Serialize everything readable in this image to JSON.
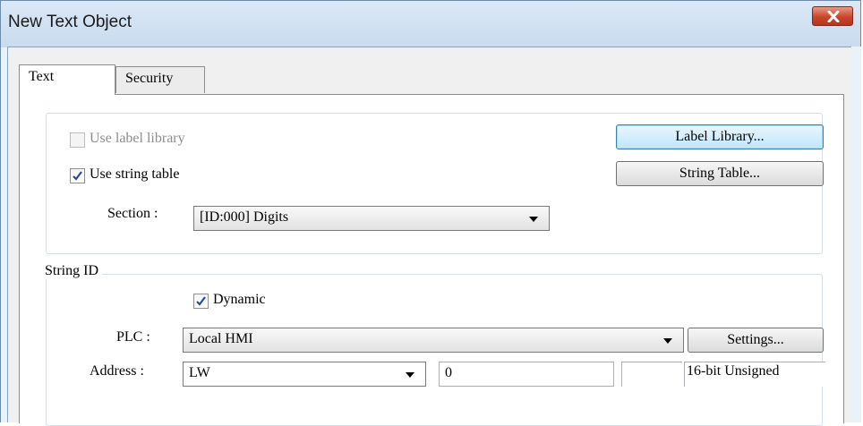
{
  "window": {
    "title": "New Text Object",
    "close_icon": "close-icon",
    "colors": {
      "titlebar": "#c9dbef",
      "close_button": "#c9452b",
      "panel": "#ffffff",
      "default_button": "#bee6fd"
    }
  },
  "tabs": [
    {
      "label": "Text",
      "active": true
    },
    {
      "label": "Security",
      "active": false
    }
  ],
  "label_options": {
    "use_label_library": {
      "label": "Use label library",
      "checked": false,
      "enabled": false
    },
    "use_string_table": {
      "label": "Use string table",
      "checked": true,
      "enabled": true
    },
    "label_library_button": "Label Library...",
    "string_table_button": "String Table...",
    "section": {
      "label": "Section :",
      "value": "[ID:000] Digits"
    }
  },
  "string_id": {
    "group_label": "String ID",
    "dynamic": {
      "label": "Dynamic",
      "checked": true
    },
    "plc": {
      "label": "PLC :",
      "value": "Local HMI",
      "settings_button": "Settings..."
    },
    "address": {
      "label": "Address :",
      "device": "LW",
      "value": "0",
      "extra": "",
      "format": "16-bit Unsigned"
    }
  }
}
